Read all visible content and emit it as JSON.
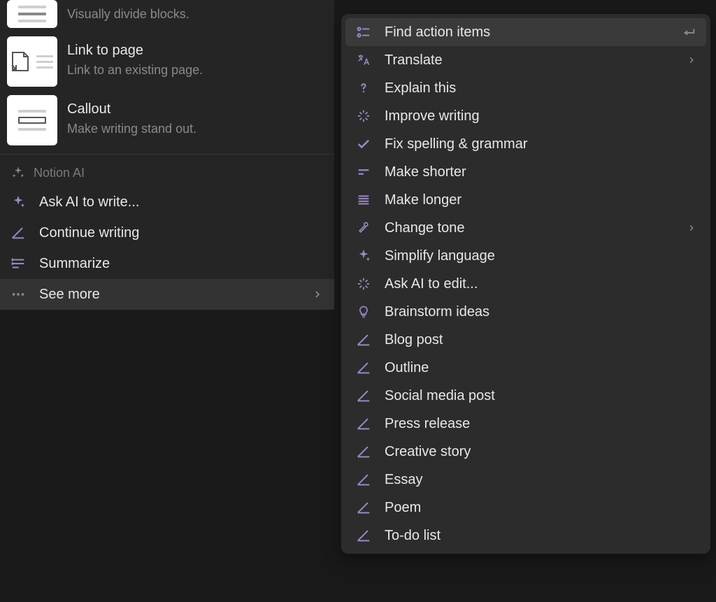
{
  "left": {
    "blocks": [
      {
        "title": "",
        "desc": "Visually divide blocks."
      },
      {
        "title": "Link to page",
        "desc": "Link to an existing page."
      },
      {
        "title": "Callout",
        "desc": "Make writing stand out."
      }
    ],
    "ai_section_label": "Notion AI",
    "ai_items": [
      {
        "label": "Ask AI to write..."
      },
      {
        "label": "Continue writing"
      },
      {
        "label": "Summarize"
      },
      {
        "label": "See more"
      }
    ]
  },
  "right": {
    "items": [
      {
        "label": "Find action items"
      },
      {
        "label": "Translate"
      },
      {
        "label": "Explain this"
      },
      {
        "label": "Improve writing"
      },
      {
        "label": "Fix spelling & grammar"
      },
      {
        "label": "Make shorter"
      },
      {
        "label": "Make longer"
      },
      {
        "label": "Change tone"
      },
      {
        "label": "Simplify language"
      },
      {
        "label": "Ask AI to edit..."
      },
      {
        "label": "Brainstorm ideas"
      },
      {
        "label": "Blog post"
      },
      {
        "label": "Outline"
      },
      {
        "label": "Social media post"
      },
      {
        "label": "Press release"
      },
      {
        "label": "Creative story"
      },
      {
        "label": "Essay"
      },
      {
        "label": "Poem"
      },
      {
        "label": "To-do list"
      }
    ]
  }
}
